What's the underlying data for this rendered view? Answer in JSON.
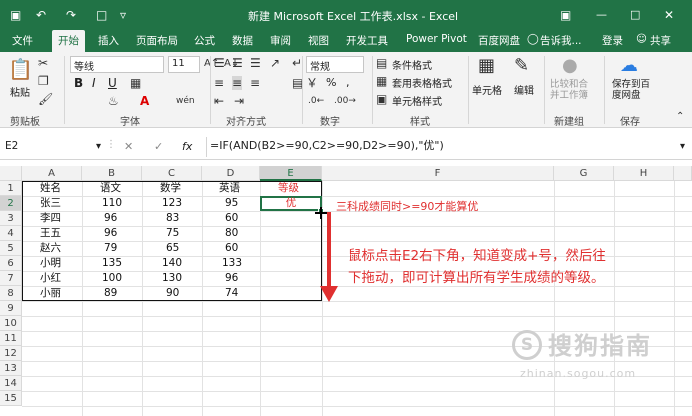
{
  "titlebar": {
    "title": "新建 Microsoft Excel 工作表.xlsx - Excel",
    "minimize_icon": "minimize-icon",
    "restore_icon": "restore-icon",
    "close_icon": "close-icon"
  },
  "tabs": [
    "文件",
    "开始",
    "插入",
    "页面布局",
    "公式",
    "数据",
    "审阅",
    "视图",
    "开发工具",
    "Power Pivot",
    "百度网盘"
  ],
  "tell_me": "告诉我...",
  "login": "登录",
  "share": "共享",
  "ribbon": {
    "paste": "粘贴",
    "clipboard": "剪贴板",
    "font_name": "等线",
    "font_size": "11",
    "bold": "B",
    "italic": "I",
    "underline": "U",
    "font_group": "字体",
    "align_group": "对齐方式",
    "number_format": "常规",
    "percent": "%",
    "comma": ",",
    "number_group": "数字",
    "cond_format": "条件格式",
    "table_format": "套用表格格式",
    "cell_style": "单元格样式",
    "style_group": "样式",
    "cells": "单元格",
    "edit": "编辑",
    "compare_merge": "比较和合并工作簿",
    "new_group": "新建组",
    "save_to": "保存到百度网盘",
    "save_group": "保存"
  },
  "formula_bar": {
    "name_box": "E2",
    "fx": "fx",
    "formula": "=IF(AND(B2>=90,C2>=90,D2>=90),\"优\")"
  },
  "columns": [
    "A",
    "B",
    "C",
    "D",
    "E",
    "F",
    "G",
    "H"
  ],
  "rows": [
    "1",
    "2",
    "3",
    "4",
    "5",
    "6",
    "7",
    "8",
    "9",
    "10",
    "11",
    "12",
    "13",
    "14",
    "15"
  ],
  "table": {
    "headers": [
      "姓名",
      "语文",
      "数学",
      "英语",
      "等级"
    ],
    "data": [
      [
        "张三",
        "110",
        "123",
        "95",
        "优"
      ],
      [
        "李四",
        "96",
        "83",
        "60",
        ""
      ],
      [
        "王五",
        "96",
        "75",
        "80",
        ""
      ],
      [
        "赵六",
        "79",
        "65",
        "60",
        ""
      ],
      [
        "小明",
        "135",
        "140",
        "133",
        ""
      ],
      [
        "小红",
        "100",
        "130",
        "96",
        ""
      ],
      [
        "小丽",
        "89",
        "90",
        "74",
        ""
      ]
    ]
  },
  "annotations": {
    "note1": "三科成绩同时>=90才能算优",
    "note2_line1": "鼠标点击E2右下角，知道变成+号，然后往",
    "note2_line2": "下拖动，即可计算出所有学生成绩的等级。"
  },
  "watermark": {
    "brand": "搜狗指南",
    "url": "zhinan.sogou.com"
  },
  "colors": {
    "excel_green": "#217346",
    "red": "#e03030",
    "watermark": "#cfcfcf"
  }
}
